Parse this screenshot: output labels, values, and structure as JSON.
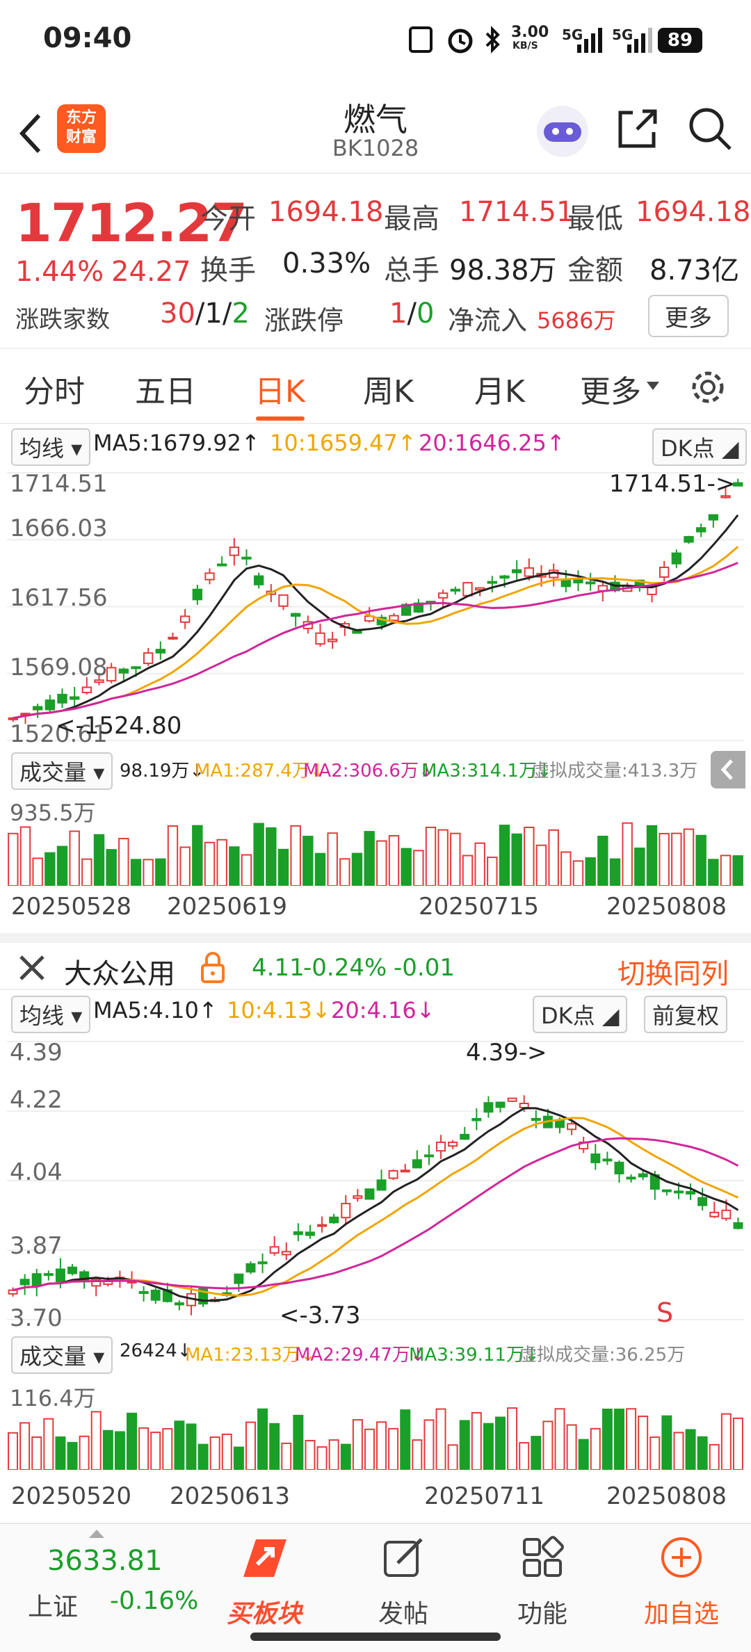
{
  "status_bar": {
    "time": "09:40",
    "net_speed_top": "3.00",
    "net_speed_unit": "KB/S",
    "signal1": "5G",
    "signal2": "5G",
    "battery": "89"
  },
  "nav": {
    "logo_line1": "东方",
    "logo_line2": "财富",
    "title": "燃气",
    "code": "BK1028"
  },
  "quote": {
    "price": "1712.27",
    "change_pct": "1.44%",
    "change_abs": "24.27",
    "open_label": "今开",
    "open": "1694.18",
    "high_label": "最高",
    "high": "1714.51",
    "low_label": "最低",
    "low": "1694.18",
    "turnover_label": "换手",
    "turnover": "0.33%",
    "volume_label": "总手",
    "volume": "98.38万",
    "amount_label": "金额",
    "amount": "8.73亿",
    "updown_label": "涨跌家数",
    "up_count": "30",
    "flat_count": "1",
    "down_count": "2",
    "limit_label": "涨跌停",
    "limit_up": "1",
    "limit_down": "0",
    "netflow_label": "净流入",
    "netflow": "5686万",
    "more_button": "更多",
    "slash": "/"
  },
  "tabs": [
    "分时",
    "五日",
    "日K",
    "周K",
    "月K",
    "更多"
  ],
  "chart1": {
    "ma_select": "均线",
    "ma5": "MA5:1679.92↑",
    "ma10": "10:1659.47↑",
    "ma20": "20:1646.25↑",
    "dk_button": "DK点",
    "y_labels": [
      "1714.51",
      "1666.03",
      "1617.56",
      "1569.08",
      "1520.61"
    ],
    "high_marker": "1714.51->",
    "low_marker": "<-1524.80",
    "vol_select": "成交量",
    "vol_value": "98.19万↓",
    "vol_ma1": "MA1:287.4万↓",
    "vol_ma2": "MA2:306.6万↓",
    "vol_ma3": "MA3:314.1万↓",
    "vol_virtual": "虚拟成交量:413.3万",
    "vol_max": "935.5万",
    "dates": [
      "20250528",
      "20250619",
      "20250715",
      "20250808"
    ]
  },
  "compare": {
    "name": "大众公用",
    "price": "4.11",
    "change_pct": "-0.24%",
    "change_abs": "-0.01",
    "switch_label": "切换同列",
    "ma_select": "均线",
    "ma5": "MA5:4.10↑",
    "ma10": "10:4.13↓",
    "ma20": "20:4.16↓",
    "dk_button": "DK点",
    "fq_button": "前复权",
    "y_labels": [
      "4.39",
      "4.22",
      "4.04",
      "3.87",
      "3.70"
    ],
    "high_marker": "4.39->",
    "low_marker": "<-3.73",
    "s_marker": "S",
    "vol_select": "成交量",
    "vol_value": "26424↓",
    "vol_ma1": "MA1:23.13万↓",
    "vol_ma2": "MA2:29.47万↓",
    "vol_ma3": "MA3:39.11万↓",
    "vol_virtual": "虚拟成交量:36.25万",
    "vol_max": "116.4万",
    "dates": [
      "20250520",
      "20250613",
      "20250711",
      "20250808"
    ]
  },
  "bottom_nav": {
    "index_value": "3633.81",
    "index_name": "上证",
    "index_change": "-0.16%",
    "items": [
      "买板块",
      "发帖",
      "功能",
      "加自选"
    ]
  },
  "colors": {
    "up": "#e4393c",
    "down": "#1a9f29",
    "accent": "#ff5a1f",
    "ma5": "#222222",
    "ma10": "#f0a500",
    "ma20": "#d0259a"
  }
}
